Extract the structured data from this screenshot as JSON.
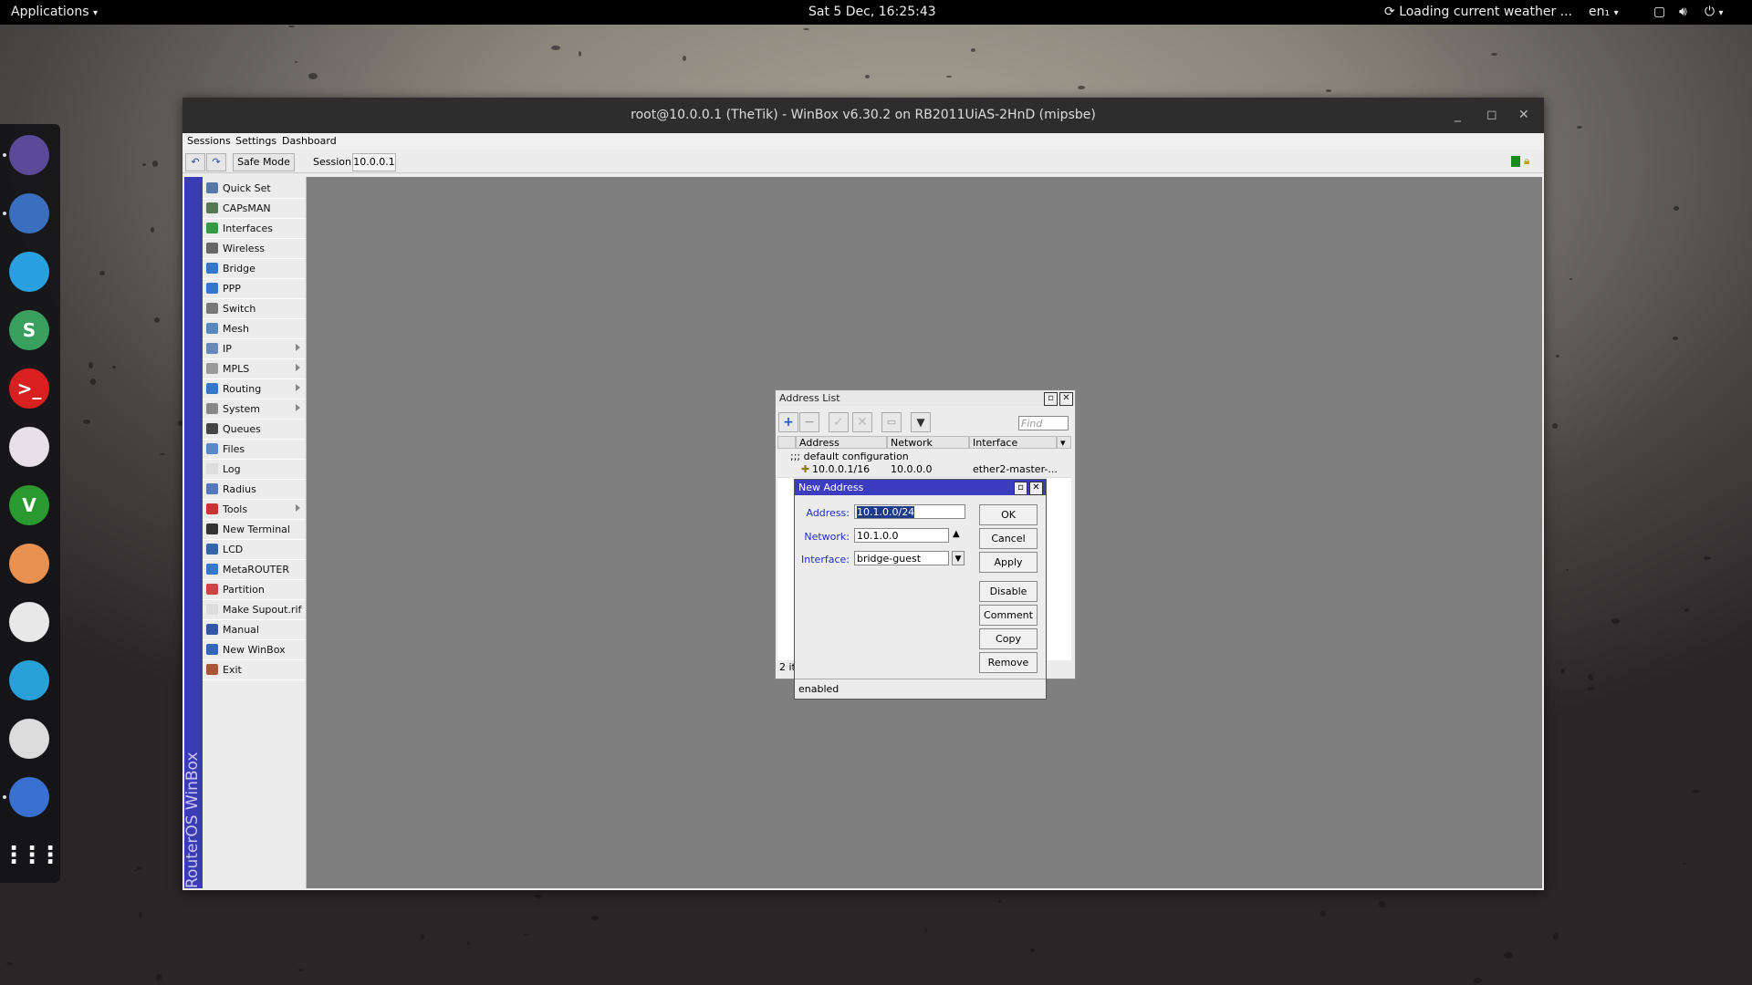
{
  "topbar": {
    "applications": "Applications",
    "clock": "Sat  5 Dec, 16:25:43",
    "weather": "Loading current weather ...",
    "keyboard": "en₁"
  },
  "dock": {
    "apps": [
      {
        "icon": "files-icon",
        "color": "#5a4a9a"
      },
      {
        "icon": "thunderbird-icon",
        "color": "#3a6fc0"
      },
      {
        "icon": "mail-icon",
        "color": "#2aa0e0"
      },
      {
        "icon": "slack-icon",
        "color": "#3aa060",
        "glyph": "S"
      },
      {
        "icon": "terminal-icon",
        "color": "#d82020",
        "glyph": ">_"
      },
      {
        "icon": "atom-icon",
        "color": "#e8e0e8"
      },
      {
        "icon": "vim-icon",
        "color": "#2a9a30",
        "glyph": "V"
      },
      {
        "icon": "speaker-icon",
        "color": "#e89050"
      },
      {
        "icon": "clock-icon",
        "color": "#e8e8e8"
      },
      {
        "icon": "monitor-icon",
        "color": "#2aa0d8"
      },
      {
        "icon": "settings-toggle-icon",
        "color": "#dcdcdc"
      },
      {
        "icon": "winbox-icon",
        "color": "#3a70d0"
      }
    ],
    "grid_icon": "app-grid-icon"
  },
  "window": {
    "title": "root@10.0.0.1 (TheTik) - WinBox v6.30.2 on RB2011UiAS-2HnD (mipsbe)",
    "menus": [
      "Sessions",
      "Settings",
      "Dashboard"
    ],
    "toolbar": {
      "undo_icon": "undo-icon",
      "redo_icon": "redo-icon",
      "safe_mode": "Safe Mode",
      "session_label": "Session:",
      "session_value": "10.0.0.1"
    },
    "brand": "RouterOS WinBox",
    "sidebar": [
      {
        "label": "Quick Set",
        "icon": "quickset-icon",
        "color": "#5577aa",
        "sub": false
      },
      {
        "label": "CAPsMAN",
        "icon": "capsman-icon",
        "color": "#557755",
        "sub": false
      },
      {
        "label": "Interfaces",
        "icon": "interfaces-icon",
        "color": "#339944",
        "sub": false
      },
      {
        "label": "Wireless",
        "icon": "wireless-icon",
        "color": "#666666",
        "sub": false
      },
      {
        "label": "Bridge",
        "icon": "bridge-icon",
        "color": "#3377cc",
        "sub": false
      },
      {
        "label": "PPP",
        "icon": "ppp-icon",
        "color": "#3377cc",
        "sub": false
      },
      {
        "label": "Switch",
        "icon": "switch-icon",
        "color": "#777777",
        "sub": false
      },
      {
        "label": "Mesh",
        "icon": "mesh-icon",
        "color": "#5588bb",
        "sub": false
      },
      {
        "label": "IP",
        "icon": "ip-icon",
        "color": "#6688bb",
        "sub": true
      },
      {
        "label": "MPLS",
        "icon": "mpls-icon",
        "color": "#999999",
        "sub": true
      },
      {
        "label": "Routing",
        "icon": "routing-icon",
        "color": "#3377cc",
        "sub": true
      },
      {
        "label": "System",
        "icon": "system-icon",
        "color": "#888888",
        "sub": true
      },
      {
        "label": "Queues",
        "icon": "queues-icon",
        "color": "#444444",
        "sub": false
      },
      {
        "label": "Files",
        "icon": "files-icon",
        "color": "#5588cc",
        "sub": false
      },
      {
        "label": "Log",
        "icon": "log-icon",
        "color": "#dddddd",
        "sub": false
      },
      {
        "label": "Radius",
        "icon": "radius-icon",
        "color": "#5577bb",
        "sub": false
      },
      {
        "label": "Tools",
        "icon": "tools-icon",
        "color": "#cc3333",
        "sub": true
      },
      {
        "label": "New Terminal",
        "icon": "terminal-icon",
        "color": "#333333",
        "sub": false
      },
      {
        "label": "LCD",
        "icon": "lcd-icon",
        "color": "#3366aa",
        "sub": false
      },
      {
        "label": "MetaROUTER",
        "icon": "metarouter-icon",
        "color": "#3377cc",
        "sub": false
      },
      {
        "label": "Partition",
        "icon": "partition-icon",
        "color": "#cc4444",
        "sub": false
      },
      {
        "label": "Make Supout.rif",
        "icon": "supout-icon",
        "color": "#dddddd",
        "sub": false
      },
      {
        "label": "Manual",
        "icon": "manual-icon",
        "color": "#3355aa",
        "sub": false
      },
      {
        "label": "New WinBox",
        "icon": "winbox-icon",
        "color": "#3366bb",
        "sub": false
      },
      {
        "label": "Exit",
        "icon": "exit-icon",
        "color": "#aa5533",
        "sub": false
      }
    ]
  },
  "address_list": {
    "title": "Address List",
    "find_placeholder": "Find",
    "columns": [
      "Address",
      "Network",
      "Interface"
    ],
    "comment": ";;; default configuration",
    "rows": [
      {
        "address": "10.0.0.1/16",
        "network": "10.0.0.0",
        "interface": "ether2-master-..."
      }
    ],
    "count": "2 it"
  },
  "new_address": {
    "title": "New Address",
    "fields": {
      "address_label": "Address:",
      "address_value": "10.1.0.0/24",
      "network_label": "Network:",
      "network_value": "10.1.0.0",
      "interface_label": "Interface:",
      "interface_value": "bridge-guest"
    },
    "buttons": [
      "OK",
      "Cancel",
      "Apply",
      "Disable",
      "Comment",
      "Copy",
      "Remove"
    ],
    "status": "enabled"
  }
}
